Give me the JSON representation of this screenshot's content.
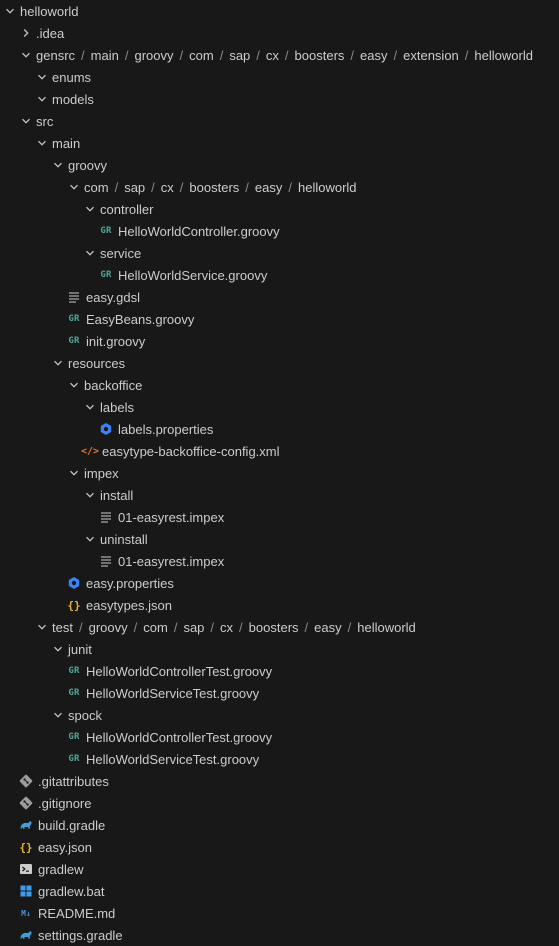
{
  "explorer": {
    "items": [
      {
        "label": "helloworld",
        "depth": 0,
        "kind": "folder",
        "open": true
      },
      {
        "label": ".idea",
        "depth": 1,
        "kind": "folder",
        "open": false
      },
      {
        "label": "gensrc / main / groovy / com / sap / cx / boosters / easy / extension / helloworld",
        "depth": 1,
        "kind": "folder",
        "open": true
      },
      {
        "label": "enums",
        "depth": 2,
        "kind": "folder",
        "open": true
      },
      {
        "label": "models",
        "depth": 2,
        "kind": "folder",
        "open": true
      },
      {
        "label": "src",
        "depth": 1,
        "kind": "folder",
        "open": true
      },
      {
        "label": "main",
        "depth": 2,
        "kind": "folder",
        "open": true
      },
      {
        "label": "groovy",
        "depth": 3,
        "kind": "folder",
        "open": true
      },
      {
        "label": "com / sap / cx / boosters / easy / helloworld",
        "depth": 4,
        "kind": "folder",
        "open": true
      },
      {
        "label": "controller",
        "depth": 5,
        "kind": "folder",
        "open": true
      },
      {
        "label": "HelloWorldController.groovy",
        "depth": 6,
        "kind": "file",
        "icon": "groovy-icon"
      },
      {
        "label": "service",
        "depth": 5,
        "kind": "folder",
        "open": true
      },
      {
        "label": "HelloWorldService.groovy",
        "depth": 6,
        "kind": "file",
        "icon": "groovy-icon"
      },
      {
        "label": "easy.gdsl",
        "depth": 4,
        "kind": "file",
        "icon": "text-lines-icon"
      },
      {
        "label": "EasyBeans.groovy",
        "depth": 4,
        "kind": "file",
        "icon": "groovy-icon"
      },
      {
        "label": "init.groovy",
        "depth": 4,
        "kind": "file",
        "icon": "groovy-icon"
      },
      {
        "label": "resources",
        "depth": 3,
        "kind": "folder",
        "open": true
      },
      {
        "label": "backoffice",
        "depth": 4,
        "kind": "folder",
        "open": true
      },
      {
        "label": "labels",
        "depth": 5,
        "kind": "folder",
        "open": true
      },
      {
        "label": "labels.properties",
        "depth": 6,
        "kind": "file",
        "icon": "properties-icon"
      },
      {
        "label": "easytype-backoffice-config.xml",
        "depth": 5,
        "kind": "file",
        "icon": "xml-icon"
      },
      {
        "label": "impex",
        "depth": 4,
        "kind": "folder",
        "open": true
      },
      {
        "label": "install",
        "depth": 5,
        "kind": "folder",
        "open": true
      },
      {
        "label": "01-easyrest.impex",
        "depth": 6,
        "kind": "file",
        "icon": "text-lines-icon"
      },
      {
        "label": "uninstall",
        "depth": 5,
        "kind": "folder",
        "open": true
      },
      {
        "label": "01-easyrest.impex",
        "depth": 6,
        "kind": "file",
        "icon": "text-lines-icon"
      },
      {
        "label": "easy.properties",
        "depth": 4,
        "kind": "file",
        "icon": "properties-icon"
      },
      {
        "label": "easytypes.json",
        "depth": 4,
        "kind": "file",
        "icon": "json-icon"
      },
      {
        "label": "test / groovy / com / sap / cx / boosters / easy / helloworld",
        "depth": 2,
        "kind": "folder",
        "open": true
      },
      {
        "label": "junit",
        "depth": 3,
        "kind": "folder",
        "open": true
      },
      {
        "label": "HelloWorldControllerTest.groovy",
        "depth": 4,
        "kind": "file",
        "icon": "groovy-icon"
      },
      {
        "label": "HelloWorldServiceTest.groovy",
        "depth": 4,
        "kind": "file",
        "icon": "groovy-icon"
      },
      {
        "label": "spock",
        "depth": 3,
        "kind": "folder",
        "open": true
      },
      {
        "label": "HelloWorldControllerTest.groovy",
        "depth": 4,
        "kind": "file",
        "icon": "groovy-icon"
      },
      {
        "label": "HelloWorldServiceTest.groovy",
        "depth": 4,
        "kind": "file",
        "icon": "groovy-icon"
      },
      {
        "label": ".gitattributes",
        "depth": 1,
        "kind": "file",
        "icon": "git-icon"
      },
      {
        "label": ".gitignore",
        "depth": 1,
        "kind": "file",
        "icon": "git-icon"
      },
      {
        "label": "build.gradle",
        "depth": 1,
        "kind": "file",
        "icon": "gradle-icon"
      },
      {
        "label": "easy.json",
        "depth": 1,
        "kind": "file",
        "icon": "json-icon"
      },
      {
        "label": "gradlew",
        "depth": 1,
        "kind": "file",
        "icon": "terminal-icon"
      },
      {
        "label": "gradlew.bat",
        "depth": 1,
        "kind": "file",
        "icon": "windows-icon"
      },
      {
        "label": "README.md",
        "depth": 1,
        "kind": "file",
        "icon": "markdown-icon"
      },
      {
        "label": "settings.gradle",
        "depth": 1,
        "kind": "file",
        "icon": "gradle-icon"
      }
    ]
  },
  "icon_glyphs": {
    "groovy-icon": "GR",
    "json-icon": "{}",
    "xml-icon": "</>",
    "markdown-icon": "M↓"
  },
  "colors": {
    "background": "#181818",
    "text": "#cccccc",
    "separator": "#8b8b8b",
    "groovy": "#4fa69b",
    "properties": "#3b82f6",
    "json": "#e8b339",
    "xml": "#e37933",
    "git": "#9d9d9d",
    "gradle": "#3d9fd6",
    "windows": "#3c9cf2",
    "markdown": "#4a8fd6"
  }
}
